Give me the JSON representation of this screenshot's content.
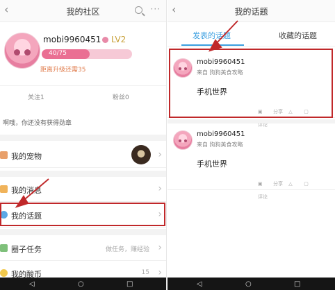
{
  "left": {
    "title": "我的社区",
    "username": "mobi9960451",
    "level": "LV2",
    "exp": {
      "text": "40/75",
      "fraction": 0.53
    },
    "exp_hint": "距离升级还需35",
    "follow": "关注1",
    "fans": "粉丝0",
    "medal": "啊哦，你还没有获得勋章",
    "menu": [
      {
        "label": "我的宠物",
        "icon": "pet-icon"
      },
      {
        "label": "我的消息",
        "icon": "message-icon"
      },
      {
        "label": "我的话题",
        "icon": "topic-icon"
      },
      {
        "label": "圈子任务",
        "icon": "task-icon",
        "extra": "做任务，赚经验"
      },
      {
        "label": "我的酸币",
        "icon": "coin-icon",
        "extra": "15"
      }
    ]
  },
  "right": {
    "title": "我的话题",
    "tabs": [
      "发表的话题",
      "收藏的话题"
    ],
    "posts": [
      {
        "name": "mobi9960451",
        "from": "来自 狗狗美食攻略",
        "body": "手机世界"
      },
      {
        "name": "mobi9960451",
        "from": "来自 狗狗美食攻略",
        "body": "手机世界"
      }
    ],
    "actions": [
      "分享",
      "评论"
    ]
  },
  "colors": {
    "accent": "#3b9fe0",
    "highlight": "#c0282a",
    "exp": "#ea6f93"
  }
}
